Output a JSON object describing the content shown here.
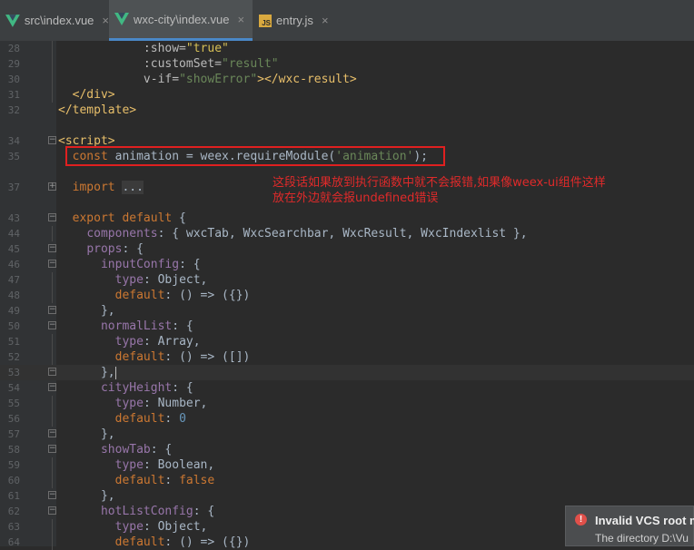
{
  "tabs": [
    {
      "label": "src\\index.vue",
      "icon": "vue-icon",
      "active": false
    },
    {
      "label": "wxc-city\\index.vue",
      "icon": "vue-icon",
      "active": true
    },
    {
      "label": "entry.js",
      "icon": "js-file-icon",
      "active": false
    }
  ],
  "close_glyph": "×",
  "js_badge": "JS",
  "lines": {
    "l28": {
      "num": "28",
      "p1": "            :show=",
      "p2": "\"true\""
    },
    "l29": {
      "num": "29",
      "p1": "            :customSet=",
      "p2": "\"result\""
    },
    "l30": {
      "num": "30",
      "p1": "            v-if=",
      "p2": "\"showError\"",
      "p3": "></wxc-result>"
    },
    "l31": {
      "num": "31",
      "p1": "  </div>"
    },
    "l32": {
      "num": "32",
      "p1": "</template>"
    },
    "l34": {
      "num": "34",
      "p1": "<script>"
    },
    "l35": {
      "num": "35",
      "kw": "const",
      "p1": " animation = weex.requireModule(",
      "str": "'animation'",
      "p2": ");"
    },
    "l37": {
      "num": "37",
      "kw": "import",
      "fold": "..."
    },
    "l43": {
      "num": "43",
      "kw": "export default",
      "p1": " {"
    },
    "l44": {
      "num": "44",
      "prop": "components",
      "p1": ": { wxcTab, WxcSearchbar, WxcResult, WxcIndexlist },"
    },
    "l45": {
      "num": "45",
      "prop": "props",
      "p1": ": {"
    },
    "l46": {
      "num": "46",
      "prop": "inputConfig",
      "p1": ": {"
    },
    "l47": {
      "num": "47",
      "prop": "type",
      "p1": ": Object,"
    },
    "l48": {
      "num": "48",
      "prop": "default",
      "p1": ": () => ({})"
    },
    "l49": {
      "num": "49",
      "p1": "},"
    },
    "l50": {
      "num": "50",
      "prop": "normalList",
      "p1": ": {"
    },
    "l51": {
      "num": "51",
      "prop": "type",
      "p1": ": Array,"
    },
    "l52": {
      "num": "52",
      "prop": "default",
      "p1": ": () => ([])"
    },
    "l53": {
      "num": "53",
      "p1": "},"
    },
    "l54": {
      "num": "54",
      "prop": "cityHeight",
      "p1": ": {"
    },
    "l55": {
      "num": "55",
      "prop": "type",
      "p1": ": Number,"
    },
    "l56": {
      "num": "56",
      "prop": "default",
      "p1": ": ",
      "numv": "0"
    },
    "l57": {
      "num": "57",
      "p1": "},"
    },
    "l58": {
      "num": "58",
      "prop": "showTab",
      "p1": ": {"
    },
    "l59": {
      "num": "59",
      "prop": "type",
      "p1": ": Boolean,"
    },
    "l60": {
      "num": "60",
      "prop": "default",
      "p1": ": ",
      "kwv": "false"
    },
    "l61": {
      "num": "61",
      "p1": "},"
    },
    "l62": {
      "num": "62",
      "prop": "hotListConfig",
      "p1": ": {"
    },
    "l63": {
      "num": "63",
      "prop": "type",
      "p1": ": Object,"
    },
    "l64": {
      "num": "64",
      "prop": "default",
      "p1": ": () => ({})"
    }
  },
  "annotation": {
    "line1": "这段话如果放到执行函数中就不会报错,如果像weex-ui组件这样",
    "line2": "放在外边就会报undefined错误"
  },
  "notification": {
    "title": "Invalid VCS root m",
    "body": "The directory D:\\Vu"
  },
  "colors": {
    "annotation_red": "#e02020",
    "tab_accent": "#4a88c7"
  }
}
